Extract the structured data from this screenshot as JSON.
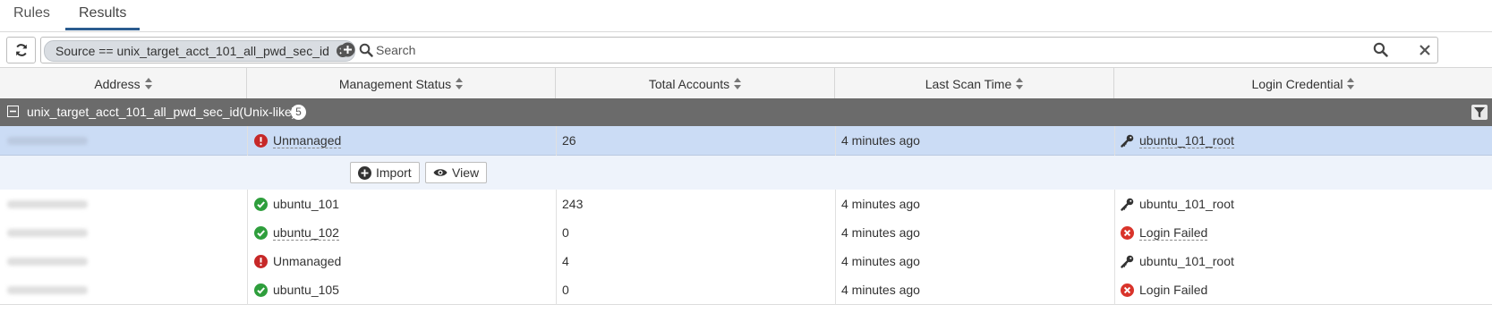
{
  "tabs": [
    {
      "label": "Rules",
      "active": false
    },
    {
      "label": "Results",
      "active": true
    }
  ],
  "filter": {
    "chip_label": "Source == unix_target_acct_101_all_pwd_sec_id",
    "search_placeholder": "Search"
  },
  "table": {
    "columns": [
      "Address",
      "Management Status",
      "Total Accounts",
      "Last Scan Time",
      "Login Credential"
    ],
    "group": {
      "label": "unix_target_acct_101_all_pwd_sec_id(Unix-like)",
      "count": "5"
    },
    "expanded_actions": {
      "import_label": "Import",
      "view_label": "View"
    },
    "rows": [
      {
        "status": "Unmanaged",
        "status_type": "warning",
        "total": "26",
        "last_scan": "4 minutes ago",
        "credential": "ubuntu_101_root",
        "credential_type": "key"
      },
      {
        "status": "ubuntu_101",
        "status_type": "ok",
        "total": "243",
        "last_scan": "4 minutes ago",
        "credential": "ubuntu_101_root",
        "credential_type": "key"
      },
      {
        "status": "ubuntu_102",
        "status_type": "ok",
        "total": "0",
        "last_scan": "4 minutes ago",
        "credential": "Login Failed",
        "credential_type": "error"
      },
      {
        "status": "Unmanaged",
        "status_type": "warning",
        "total": "4",
        "last_scan": "4 minutes ago",
        "credential": "ubuntu_101_root",
        "credential_type": "key"
      },
      {
        "status": "ubuntu_105",
        "status_type": "ok",
        "total": "0",
        "last_scan": "4 minutes ago",
        "credential": "Login Failed",
        "credential_type": "error"
      }
    ]
  },
  "colors": {
    "ok": "#2e9e3c",
    "warning": "#c62828",
    "error": "#d9342b",
    "group_bg": "#6b6b6b",
    "selected_row": "#cbdcf5",
    "tab_accent": "#2b5c8f"
  }
}
